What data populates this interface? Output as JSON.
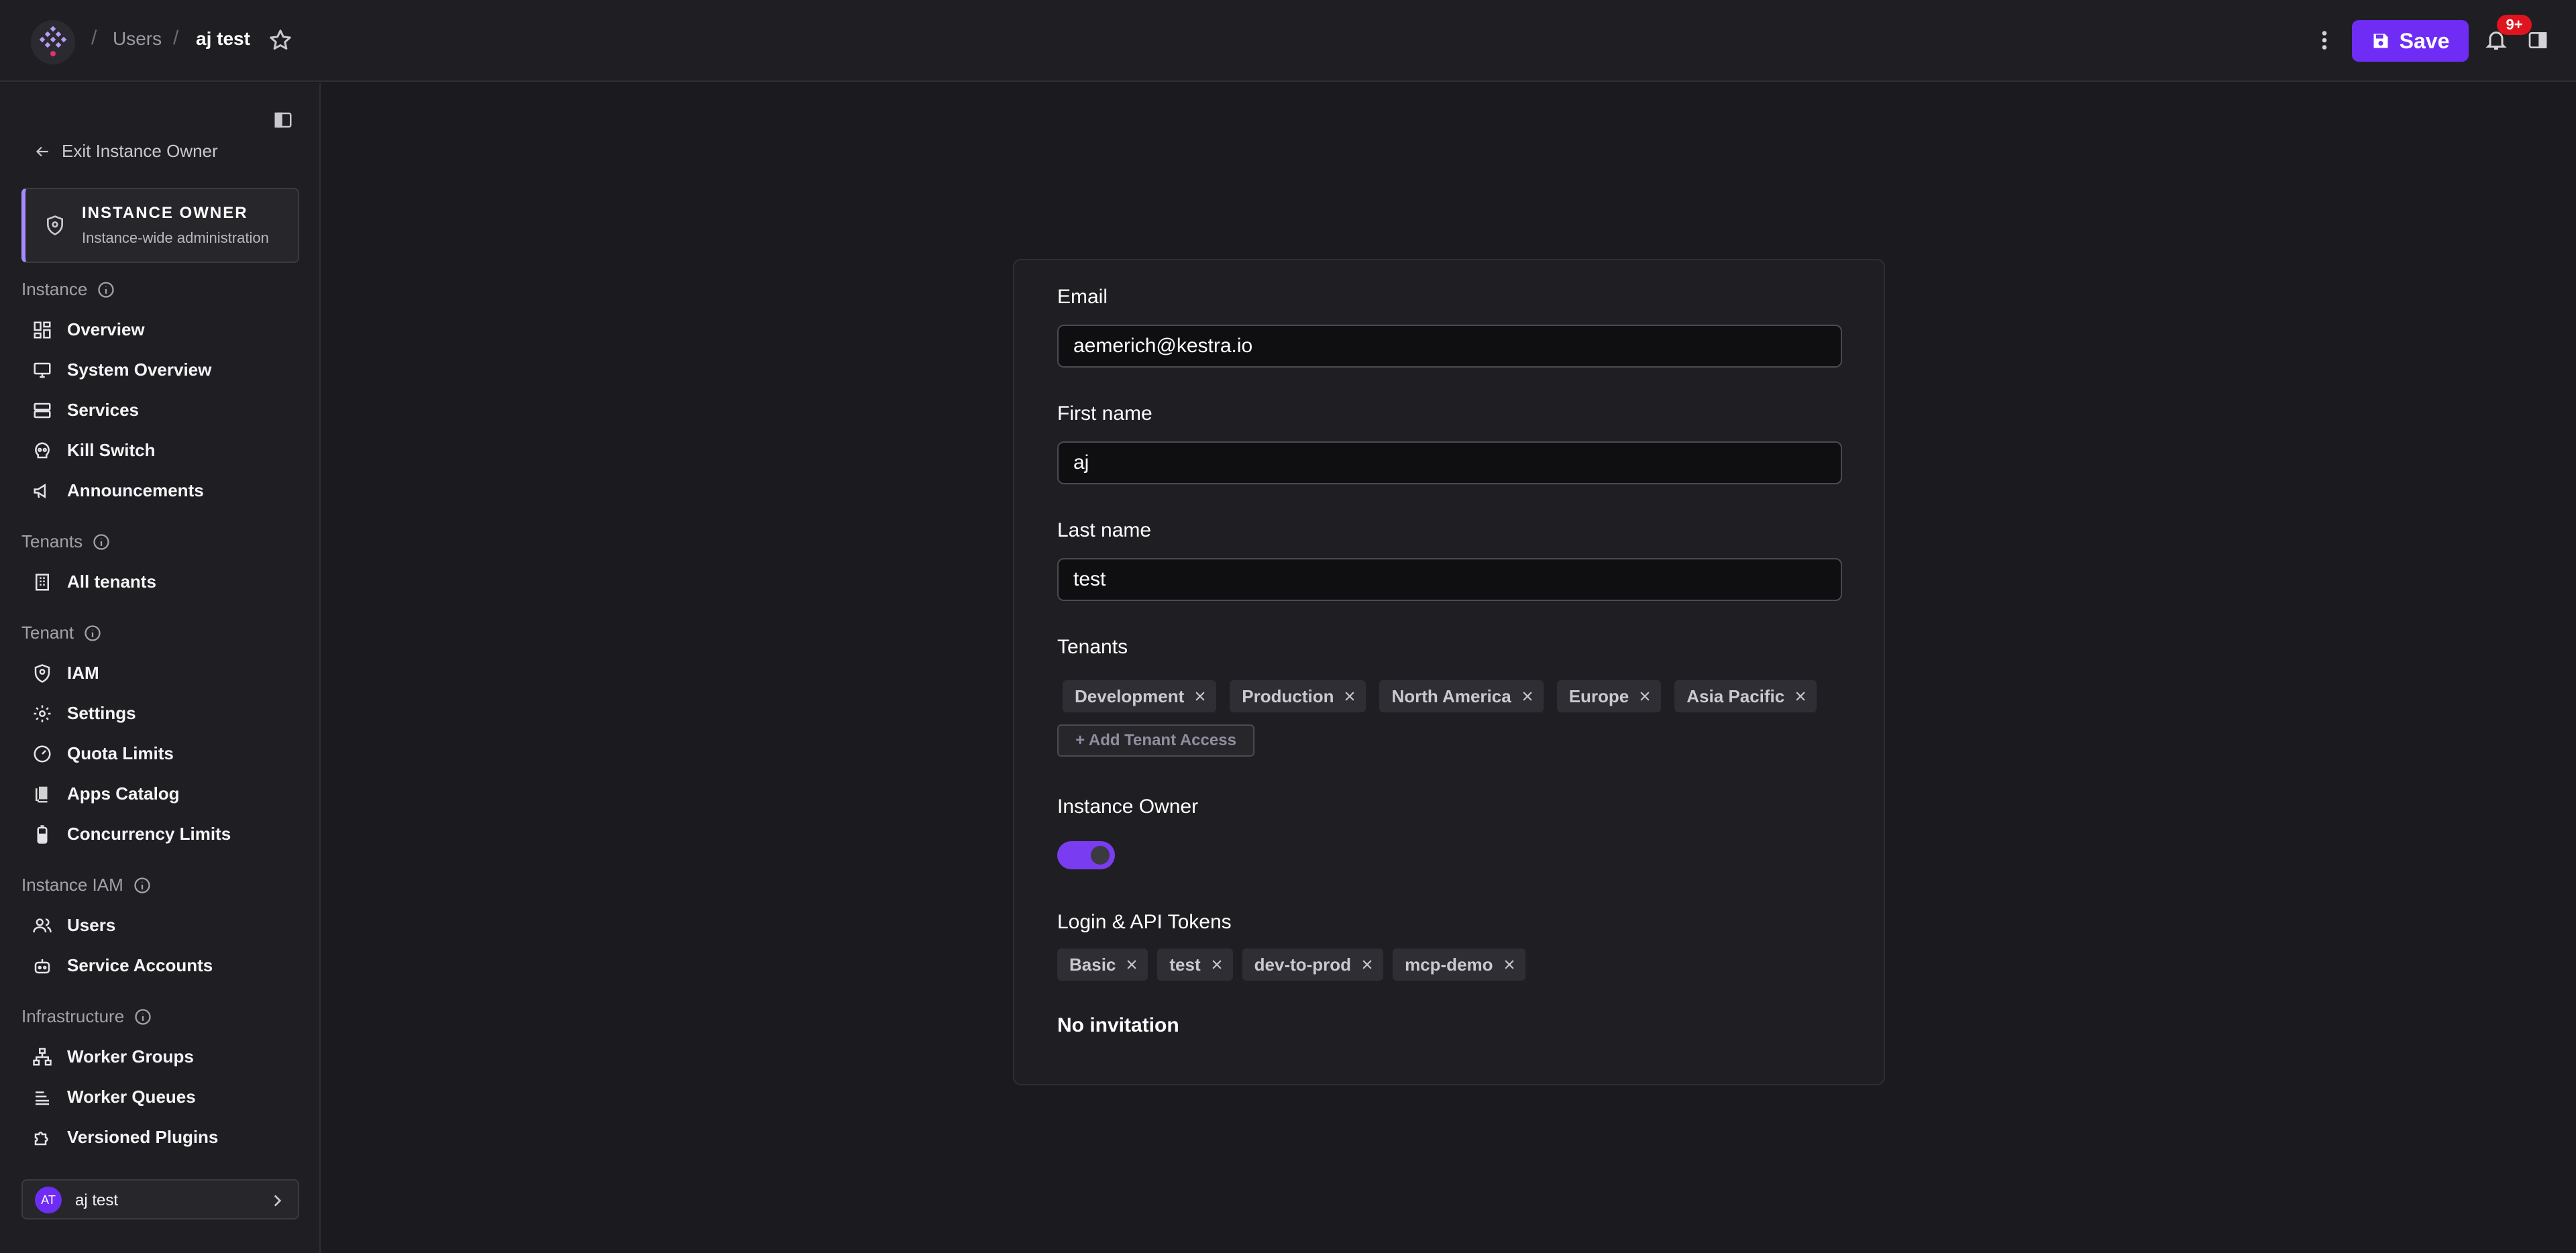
{
  "header": {
    "breadcrumb_sep": "/",
    "breadcrumb_users": "Users",
    "breadcrumb_current": "aj test",
    "save_label": "Save",
    "notification_badge": "9+",
    "accent_color": "#6f2cf5"
  },
  "sidebar": {
    "exit_label": "Exit Instance Owner",
    "owner_card": {
      "title": "INSTANCE OWNER",
      "subtitle": "Instance-wide administration"
    },
    "sections": {
      "instance": "Instance",
      "tenants": "Tenants",
      "tenant": "Tenant",
      "instance_iam": "Instance IAM",
      "infrastructure": "Infrastructure"
    },
    "items": {
      "overview": "Overview",
      "system_overview": "System Overview",
      "services": "Services",
      "kill_switch": "Kill Switch",
      "announcements": "Announcements",
      "all_tenants": "All tenants",
      "iam": "IAM",
      "settings": "Settings",
      "quota_limits": "Quota Limits",
      "apps_catalog": "Apps Catalog",
      "concurrency_limits": "Concurrency Limits",
      "users": "Users",
      "service_accounts": "Service Accounts",
      "worker_groups": "Worker Groups",
      "worker_queues": "Worker Queues",
      "versioned_plugins": "Versioned Plugins"
    },
    "user": {
      "initials": "AT",
      "name": "aj test"
    }
  },
  "form": {
    "email": {
      "label": "Email",
      "value": "aemerich@kestra.io"
    },
    "first_name": {
      "label": "First name",
      "value": "aj"
    },
    "last_name": {
      "label": "Last name",
      "value": "test"
    },
    "tenants": {
      "label": "Tenants",
      "chips": [
        "Development",
        "Production",
        "North America",
        "Europe",
        "Asia Pacific"
      ],
      "add_label": "+ Add Tenant Access"
    },
    "instance_owner": {
      "label": "Instance Owner",
      "enabled": true
    },
    "tokens": {
      "label": "Login & API Tokens",
      "chips": [
        "Basic",
        "test",
        "dev-to-prod",
        "mcp-demo"
      ]
    },
    "invitation_status": "No invitation"
  }
}
